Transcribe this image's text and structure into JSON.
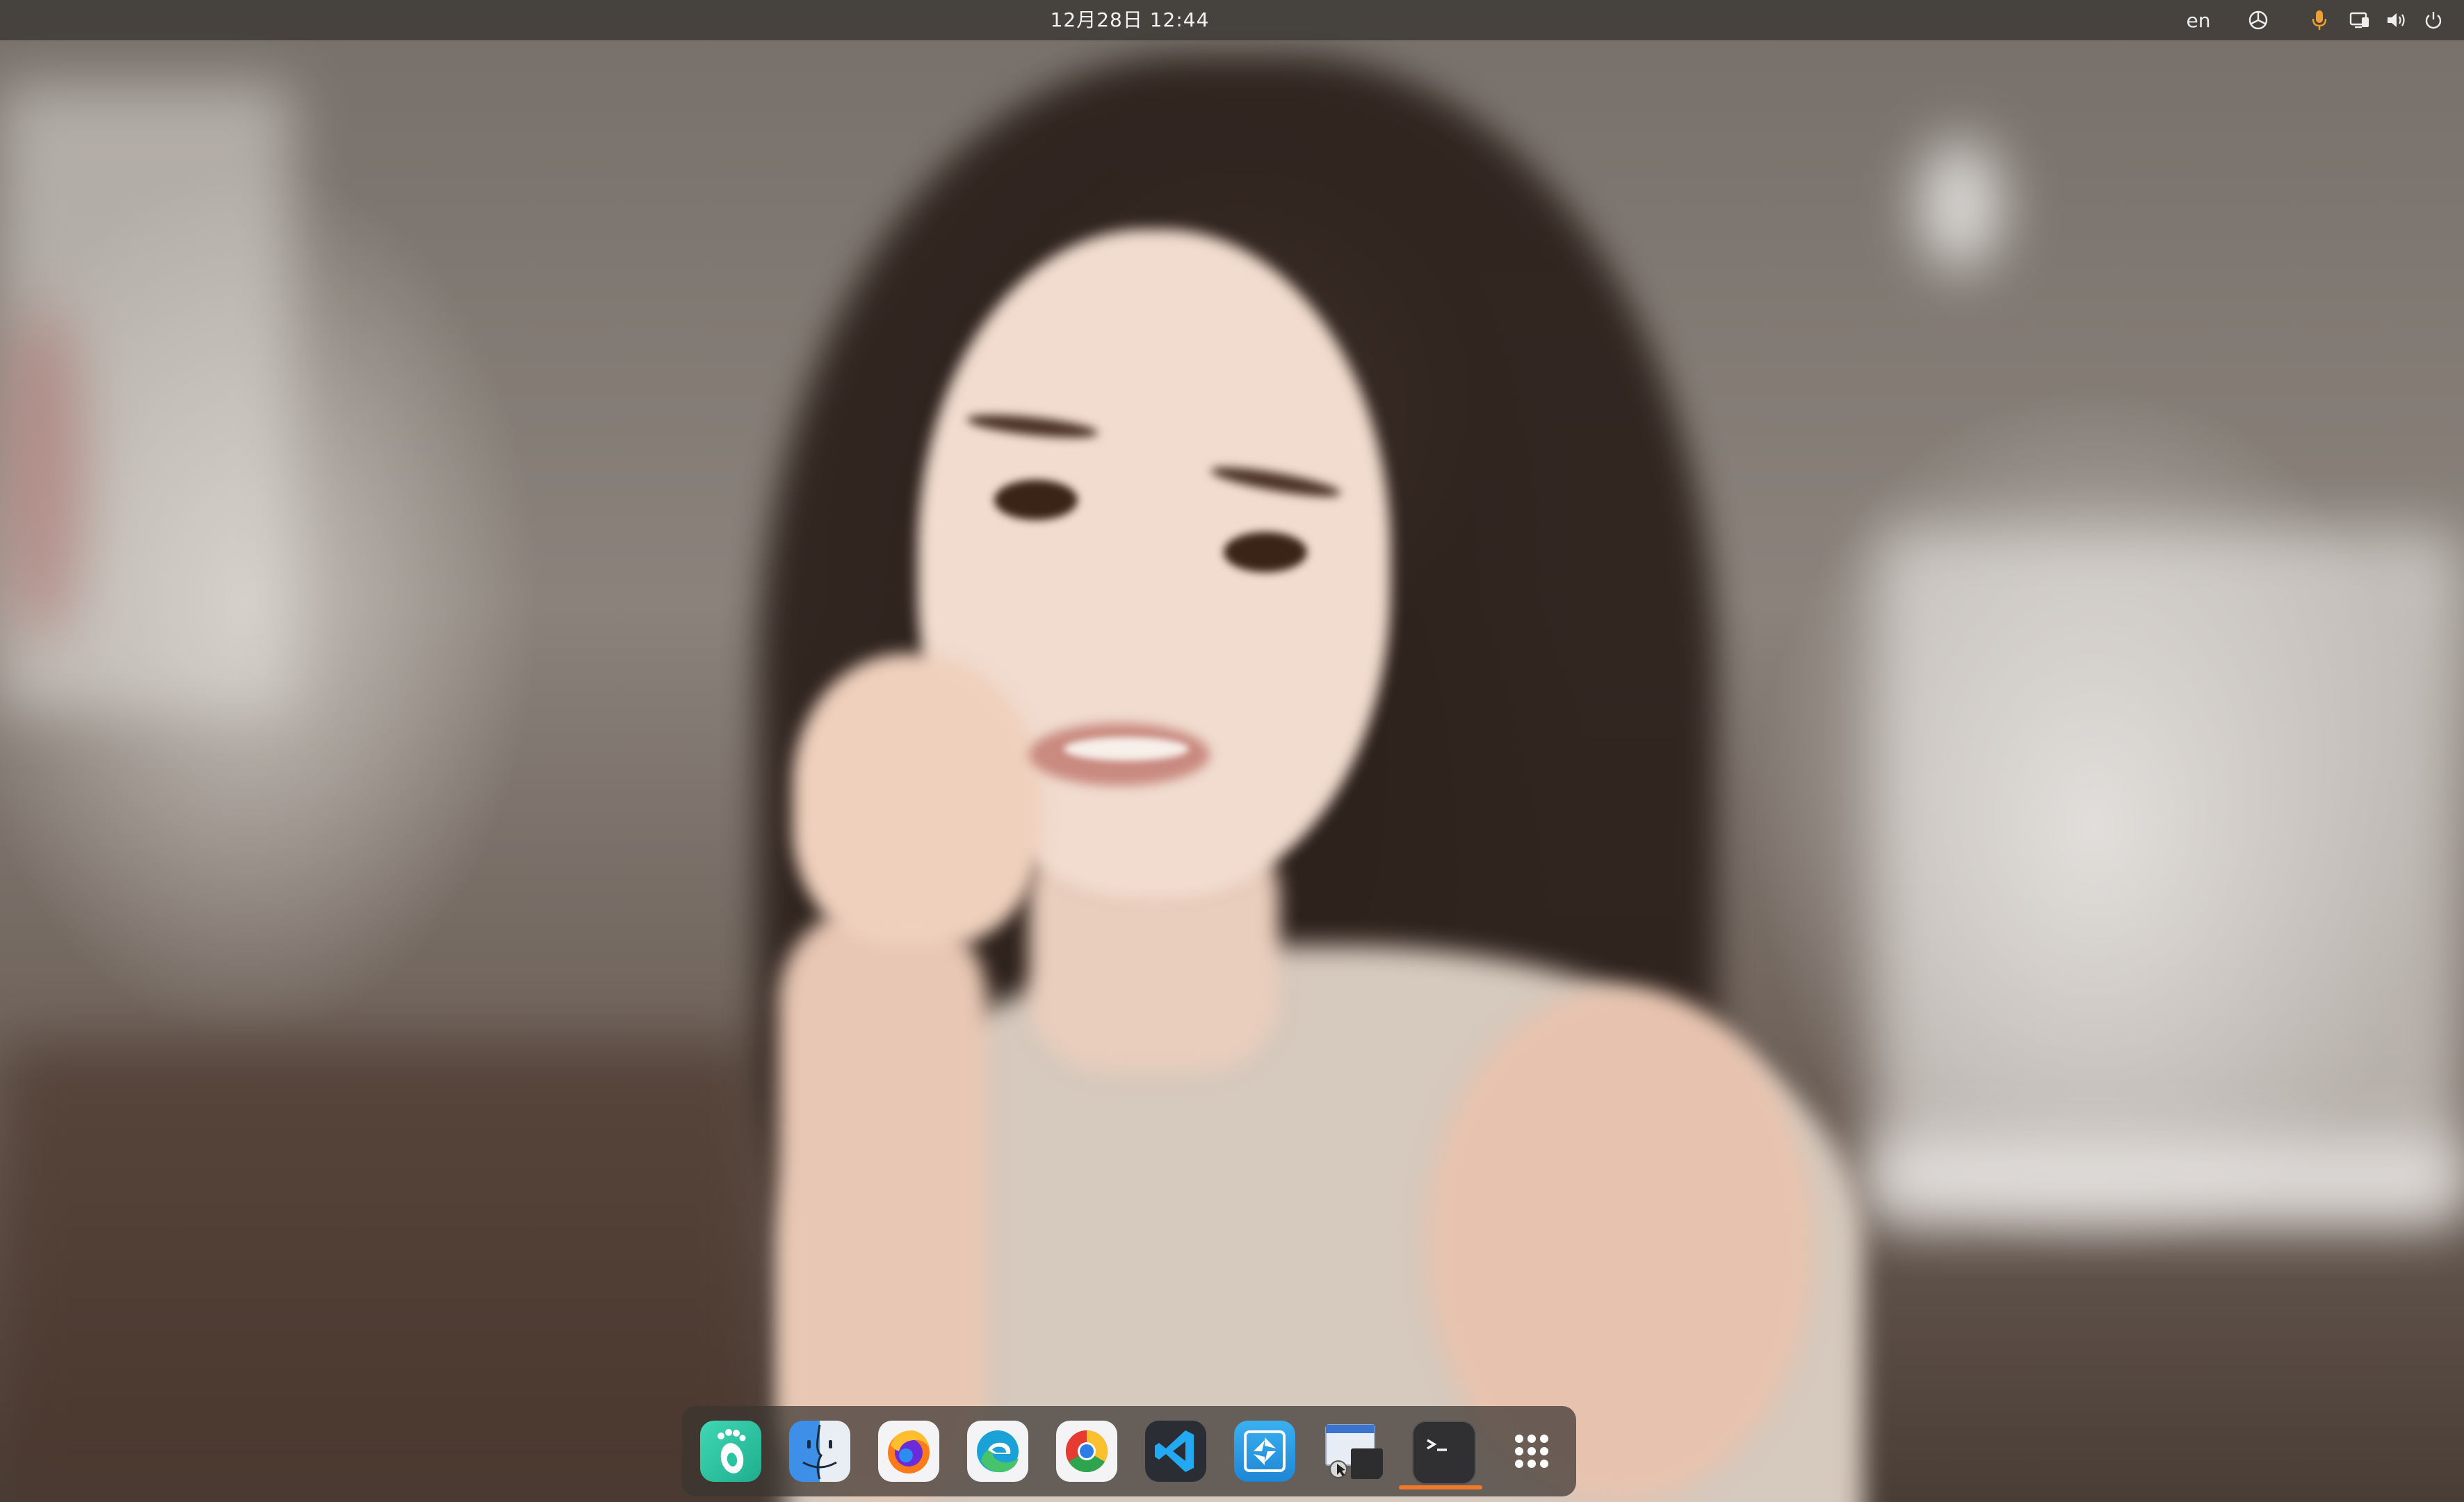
{
  "topbar": {
    "clock": "12月28日 12:44",
    "language": "en",
    "icons": [
      "network-icon",
      "microphone-icon",
      "screen-share-icon",
      "volume-icon",
      "power-icon"
    ],
    "mic_color": "#f0a030"
  },
  "wallpaper": {
    "description_icon": "portrait-wallpaper"
  },
  "dock": {
    "items": [
      {
        "name": "gnome-software",
        "icon": "gnome-foot-icon",
        "color": "#2ac3a2"
      },
      {
        "name": "finder",
        "icon": "finder-face-icon",
        "color": "#3d8fe8"
      },
      {
        "name": "firefox",
        "icon": "firefox-icon",
        "color": "#ff7a18"
      },
      {
        "name": "edge",
        "icon": "edge-icon",
        "color": "#1aa1d8"
      },
      {
        "name": "chrome",
        "icon": "chrome-icon",
        "color": "#e53b30"
      },
      {
        "name": "vscode",
        "icon": "vscode-icon",
        "color": "#23a9f2"
      },
      {
        "name": "screenshot-tool",
        "icon": "aperture-icon",
        "color": "#2aa0e8"
      },
      {
        "name": "window-tool",
        "icon": "window-cursor-icon",
        "color": "#3a73d0"
      },
      {
        "name": "terminal",
        "icon": "terminal-icon",
        "color": "#2f2f2f"
      },
      {
        "name": "show-apps",
        "icon": "app-grid-icon",
        "color": "#ffffff"
      }
    ],
    "terminal_running": true,
    "running_indicator_color": "#f07a2a",
    "terminal_prompt": ">_"
  }
}
